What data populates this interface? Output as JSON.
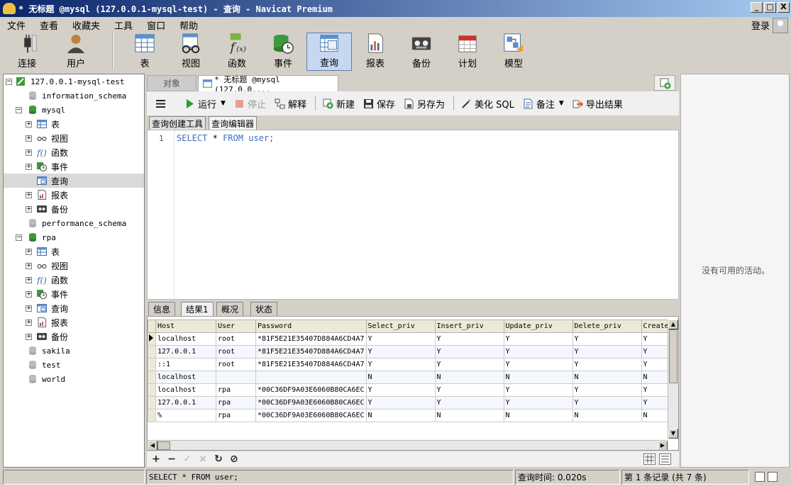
{
  "window": {
    "title": "* 无标题 @mysql (127.0.0.1-mysql-test) - 查询 - Navicat Premium",
    "min_label": "_",
    "max_label": "□",
    "close_label": "X"
  },
  "menu": [
    "文件",
    "查看",
    "收藏夹",
    "工具",
    "窗口",
    "帮助"
  ],
  "login_label": "登录",
  "toolbar": {
    "connect": "连接",
    "user": "用户",
    "table": "表",
    "view": "视图",
    "function": "函数",
    "event": "事件",
    "query": "查询",
    "report": "报表",
    "backup": "备份",
    "schedule": "计划",
    "model": "模型"
  },
  "tree": {
    "connection": "127.0.0.1-mysql-test",
    "db_information_schema": "information_schema",
    "db_mysql": "mysql",
    "db_performance_schema": "performance_schema",
    "db_rpa": "rpa",
    "db_sakila": "sakila",
    "db_test": "test",
    "db_world": "world",
    "item_table": "表",
    "item_view": "视图",
    "item_function": "函数",
    "item_event": "事件",
    "item_query": "查询",
    "item_report": "报表",
    "item_backup": "备份"
  },
  "tabs": {
    "objects": "对象",
    "query_tab": "* 无标题 @mysql (127.0.0...."
  },
  "query_toolbar": {
    "run": "运行",
    "stop": "停止",
    "explain": "解释",
    "new": "新建",
    "save": "保存",
    "save_as": "另存为",
    "beautify": "美化 SQL",
    "comment": "备注",
    "export": "导出结果"
  },
  "subtabs": {
    "builder": "查询创建工具",
    "editor": "查询编辑器"
  },
  "editor": {
    "line_number": "1",
    "kw_select": "SELECT",
    "star": "*",
    "kw_from": "FROM",
    "rest": "user;"
  },
  "result_tabs": [
    "信息",
    "结果1",
    "概况",
    "状态"
  ],
  "grid": {
    "columns": [
      "Host",
      "User",
      "Password",
      "Select_priv",
      "Insert_priv",
      "Update_priv",
      "Delete_priv",
      "Create_"
    ],
    "rows": [
      [
        "localhost",
        "root",
        "*81F5E21E35407D884A6CD4A7",
        "Y",
        "Y",
        "Y",
        "Y",
        "Y"
      ],
      [
        "127.0.0.1",
        "root",
        "*81F5E21E35407D884A6CD4A7",
        "Y",
        "Y",
        "Y",
        "Y",
        "Y"
      ],
      [
        "::1",
        "root",
        "*81F5E21E35407D884A6CD4A7",
        "Y",
        "Y",
        "Y",
        "Y",
        "Y"
      ],
      [
        "localhost",
        "",
        "",
        "N",
        "N",
        "N",
        "N",
        "N"
      ],
      [
        "localhost",
        "rpa",
        "*00C36DF9A03E6060B80CA6EC",
        "Y",
        "Y",
        "Y",
        "Y",
        "Y"
      ],
      [
        "127.0.0.1",
        "rpa",
        "*00C36DF9A03E6060B80CA6EC",
        "Y",
        "Y",
        "Y",
        "Y",
        "Y"
      ],
      [
        "%",
        "rpa",
        "*00C36DF9A03E6060B80CA6EC",
        "N",
        "N",
        "N",
        "N",
        "N"
      ]
    ]
  },
  "side_panel": {
    "message": "没有可用的活动。"
  },
  "status": {
    "sql": "SELECT * FROM user;",
    "query_time": "查询时间: 0.020s",
    "records": "第 1 条记录 (共 7 条)"
  },
  "colors": {
    "accent_active": "#c6d8f0",
    "sql_keyword": "#3b6fc4"
  }
}
